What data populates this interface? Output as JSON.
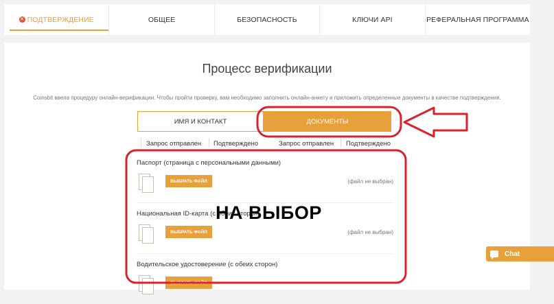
{
  "tabs": [
    {
      "label": "ПОДТВЕРЖДЕНИЕ",
      "active": true
    },
    {
      "label": "ОБЩЕЕ",
      "active": false
    },
    {
      "label": "БЕЗОПАСНОСТЬ",
      "active": false
    },
    {
      "label": "КЛЮЧИ API",
      "active": false
    },
    {
      "label": "РЕФЕРАЛЬНАЯ ПРОГРАММА",
      "active": false
    }
  ],
  "main": {
    "title": "Процесс верификации",
    "description": "Coinsbit ввела процедуру онлайн-верификации. Чтобы пройти проверку, вам необходимо заполнить онлайн-анкету и приложить определенные документы в качестве подтверждения.",
    "subtabs": {
      "name_contact": "ИМЯ И КОНТАКТ",
      "documents": "ДОКУМЕНТЫ"
    },
    "status": {
      "left": {
        "sent": "Запрос отправлен",
        "confirmed": "Подтверждено"
      },
      "right": {
        "sent": "Запрос отправлен",
        "confirmed": "Подтверждено"
      }
    },
    "documents": [
      {
        "title": "Паспорт (страница с персональными данными)",
        "button": "ВЫБРАТЬ ФАЙЛ",
        "file_status": "(файл не выбран)"
      },
      {
        "title": "Национальная ID-карта (с обеих сторон)",
        "button": "ВЫБРАТЬ ФАЙЛ",
        "file_status": "(файл не выбран)"
      },
      {
        "title": "Водительское удостоверение (с обеих сторон)",
        "button": "ВЫБРАТЬ ФАЙЛ",
        "file_status": ""
      }
    ]
  },
  "annotation": {
    "text": "НА ВЫБОР",
    "color": "#d9222e"
  },
  "chat": {
    "label": "Chat"
  },
  "colors": {
    "accent": "#e8a03a",
    "error": "#e0533c"
  }
}
